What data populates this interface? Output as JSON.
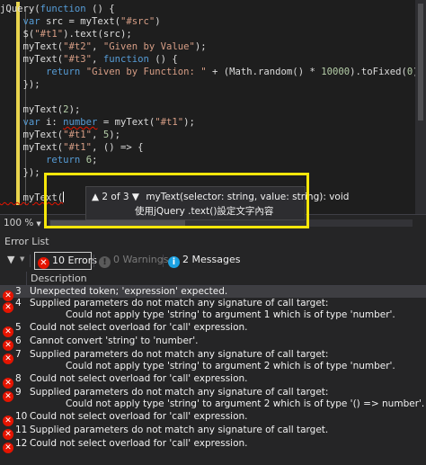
{
  "code_lines": [
    [
      {
        "t": "jQuery(",
        "c": "def"
      },
      {
        "t": "function",
        "c": "kw"
      },
      {
        "t": " () {",
        "c": "def"
      }
    ],
    [
      {
        "t": "    ",
        "c": "def"
      },
      {
        "t": "var",
        "c": "kw"
      },
      {
        "t": " src = myText(",
        "c": "def"
      },
      {
        "t": "\"#src\"",
        "c": "str"
      },
      {
        "t": ")",
        "c": "def"
      }
    ],
    [
      {
        "t": "    $(",
        "c": "def"
      },
      {
        "t": "\"#t1\"",
        "c": "str"
      },
      {
        "t": ").text(src);",
        "c": "def"
      }
    ],
    [
      {
        "t": "    myText(",
        "c": "def"
      },
      {
        "t": "\"#t2\"",
        "c": "str"
      },
      {
        "t": ", ",
        "c": "def"
      },
      {
        "t": "\"Given by Value\"",
        "c": "str"
      },
      {
        "t": ");",
        "c": "def"
      }
    ],
    [
      {
        "t": "    myText(",
        "c": "def"
      },
      {
        "t": "\"#t3\"",
        "c": "str"
      },
      {
        "t": ", ",
        "c": "def"
      },
      {
        "t": "function",
        "c": "kw"
      },
      {
        "t": " () {",
        "c": "def"
      }
    ],
    [
      {
        "t": "        ",
        "c": "def"
      },
      {
        "t": "return",
        "c": "kw"
      },
      {
        "t": " ",
        "c": "def"
      },
      {
        "t": "\"Given by Function: \"",
        "c": "str"
      },
      {
        "t": " + (Math.random() * ",
        "c": "def"
      },
      {
        "t": "10000",
        "c": "num"
      },
      {
        "t": ").toFixed(",
        "c": "def"
      },
      {
        "t": "0",
        "c": "num"
      },
      {
        "t": ");",
        "c": "def"
      }
    ],
    [
      {
        "t": "    });",
        "c": "def"
      }
    ],
    [],
    [
      {
        "t": "    myText(",
        "c": "def"
      },
      {
        "t": "2",
        "c": "num"
      },
      {
        "t": ");",
        "c": "def"
      }
    ],
    [
      {
        "t": "    ",
        "c": "def"
      },
      {
        "t": "var",
        "c": "kw"
      },
      {
        "t": " i: ",
        "c": "def"
      },
      {
        "t": "number",
        "c": "kw",
        "sq": true
      },
      {
        "t": " = myText(",
        "c": "def"
      },
      {
        "t": "\"#t1\"",
        "c": "str"
      },
      {
        "t": ");",
        "c": "def"
      }
    ],
    [
      {
        "t": "    myText(",
        "c": "def"
      },
      {
        "t": "\"#t1\"",
        "c": "str"
      },
      {
        "t": ", ",
        "c": "def"
      },
      {
        "t": "5",
        "c": "num"
      },
      {
        "t": ");",
        "c": "def"
      }
    ],
    [
      {
        "t": "    myText(",
        "c": "def"
      },
      {
        "t": "\"#t1\"",
        "c": "str"
      },
      {
        "t": ", () => {",
        "c": "def"
      }
    ],
    [
      {
        "t": "        ",
        "c": "def"
      },
      {
        "t": "return",
        "c": "kw"
      },
      {
        "t": " ",
        "c": "def"
      },
      {
        "t": "6",
        "c": "num"
      },
      {
        "t": ";",
        "c": "def"
      }
    ],
    [
      {
        "t": "    });",
        "c": "def"
      }
    ],
    [],
    [
      {
        "t": "    myText(",
        "c": "def",
        "sq": true
      }
    ],
    [],
    [
      {
        "t": "});",
        "c": "def"
      }
    ]
  ],
  "signature_help": {
    "counter": "▲ 2 of 3 ▼",
    "signature": "myText(selector: string, value: string): void",
    "description": "使用jQuery .text()設定文字內容"
  },
  "statusbar": {
    "zoom": "100 %"
  },
  "error_list": {
    "title": "Error List",
    "errors_label": "10 Errors",
    "warnings_label": "0 Warnings",
    "messages_label": "2 Messages",
    "column_description": "Description",
    "rows": [
      {
        "num": "3",
        "desc": "Unexpected token; 'expression' expected.",
        "selected": true
      },
      {
        "num": "4",
        "desc": "Supplied parameters do not match any signature of call target:\n            Could not apply type 'string' to argument 1 which is of type 'number'."
      },
      {
        "num": "5",
        "desc": "Could not select overload for 'call' expression."
      },
      {
        "num": "6",
        "desc": "Cannot convert 'string' to 'number'."
      },
      {
        "num": "7",
        "desc": "Supplied parameters do not match any signature of call target:\n            Could not apply type 'string' to argument 2 which is of type 'number'."
      },
      {
        "num": "8",
        "desc": "Could not select overload for 'call' expression."
      },
      {
        "num": "9",
        "desc": "Supplied parameters do not match any signature of call target:\n            Could not apply type 'string' to argument 2 which is of type '() => number'."
      },
      {
        "num": "10",
        "desc": "Could not select overload for 'call' expression."
      },
      {
        "num": "11",
        "desc": "Supplied parameters do not match any signature of call target."
      },
      {
        "num": "12",
        "desc": "Could not select overload for 'call' expression."
      }
    ]
  },
  "icons": {
    "error": "error-circle-icon",
    "warning": "warning-icon",
    "message": "info-icon",
    "filter": "filter-icon"
  },
  "colors": {
    "error": "#e51400",
    "highlight_box": "#f6e60a",
    "keyword": "#569cd6",
    "string": "#d69d85",
    "number": "#b5cea8",
    "info": "#1ba1e2"
  }
}
